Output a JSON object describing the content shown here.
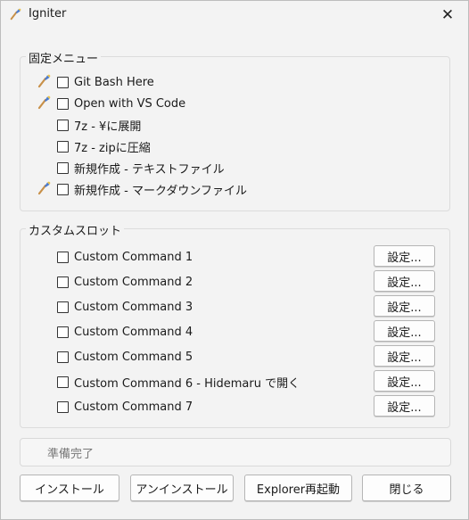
{
  "window": {
    "title": "Igniter",
    "icon": "brush-icon"
  },
  "fixed_menu": {
    "legend": "固定メニュー",
    "items": [
      {
        "label": "Git Bash Here",
        "checked": false,
        "has_icon": true
      },
      {
        "label": "Open with VS Code",
        "checked": false,
        "has_icon": true
      },
      {
        "label": "7z - ¥に展開",
        "checked": false,
        "has_icon": false
      },
      {
        "label": "7z - zipに圧縮",
        "checked": false,
        "has_icon": false
      },
      {
        "label": "新規作成 - テキストファイル",
        "checked": false,
        "has_icon": false
      },
      {
        "label": "新規作成 - マークダウンファイル",
        "checked": false,
        "has_icon": true
      }
    ]
  },
  "custom_slots": {
    "legend": "カスタムスロット",
    "settings_label": "設定...",
    "items": [
      {
        "label": "Custom Command 1",
        "checked": false
      },
      {
        "label": "Custom Command 2",
        "checked": false
      },
      {
        "label": "Custom Command 3",
        "checked": false
      },
      {
        "label": "Custom Command 4",
        "checked": false
      },
      {
        "label": "Custom Command 5",
        "checked": false
      },
      {
        "label": "Custom Command 6 - Hidemaru で開く",
        "checked": false
      },
      {
        "label": "Custom Command 7",
        "checked": false
      }
    ]
  },
  "status": {
    "text": "準備完了"
  },
  "buttons": {
    "install": "インストール",
    "uninstall": "アンインストール",
    "restart_explorer": "Explorer再起動",
    "close": "閉じる"
  }
}
